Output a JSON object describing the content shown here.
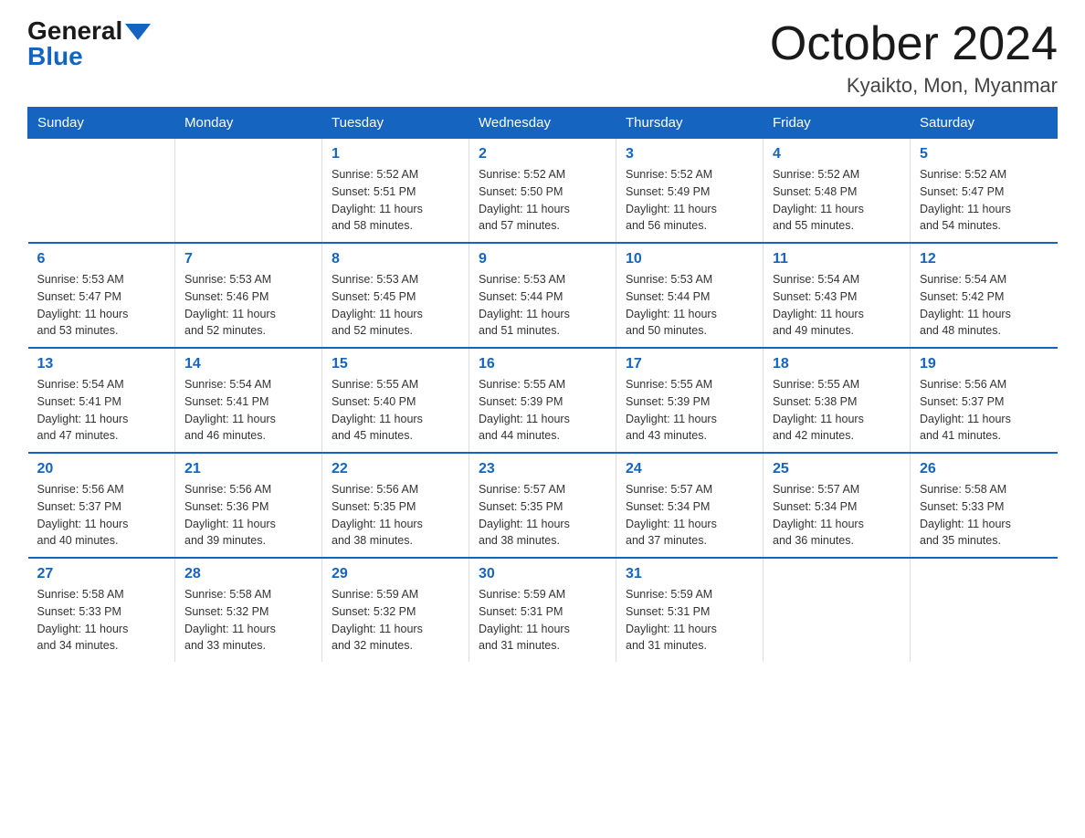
{
  "logo": {
    "general": "General",
    "blue": "Blue"
  },
  "title": "October 2024",
  "subtitle": "Kyaikto, Mon, Myanmar",
  "headers": [
    "Sunday",
    "Monday",
    "Tuesday",
    "Wednesday",
    "Thursday",
    "Friday",
    "Saturday"
  ],
  "weeks": [
    [
      {
        "day": "",
        "info": ""
      },
      {
        "day": "",
        "info": ""
      },
      {
        "day": "1",
        "info": "Sunrise: 5:52 AM\nSunset: 5:51 PM\nDaylight: 11 hours\nand 58 minutes."
      },
      {
        "day": "2",
        "info": "Sunrise: 5:52 AM\nSunset: 5:50 PM\nDaylight: 11 hours\nand 57 minutes."
      },
      {
        "day": "3",
        "info": "Sunrise: 5:52 AM\nSunset: 5:49 PM\nDaylight: 11 hours\nand 56 minutes."
      },
      {
        "day": "4",
        "info": "Sunrise: 5:52 AM\nSunset: 5:48 PM\nDaylight: 11 hours\nand 55 minutes."
      },
      {
        "day": "5",
        "info": "Sunrise: 5:52 AM\nSunset: 5:47 PM\nDaylight: 11 hours\nand 54 minutes."
      }
    ],
    [
      {
        "day": "6",
        "info": "Sunrise: 5:53 AM\nSunset: 5:47 PM\nDaylight: 11 hours\nand 53 minutes."
      },
      {
        "day": "7",
        "info": "Sunrise: 5:53 AM\nSunset: 5:46 PM\nDaylight: 11 hours\nand 52 minutes."
      },
      {
        "day": "8",
        "info": "Sunrise: 5:53 AM\nSunset: 5:45 PM\nDaylight: 11 hours\nand 52 minutes."
      },
      {
        "day": "9",
        "info": "Sunrise: 5:53 AM\nSunset: 5:44 PM\nDaylight: 11 hours\nand 51 minutes."
      },
      {
        "day": "10",
        "info": "Sunrise: 5:53 AM\nSunset: 5:44 PM\nDaylight: 11 hours\nand 50 minutes."
      },
      {
        "day": "11",
        "info": "Sunrise: 5:54 AM\nSunset: 5:43 PM\nDaylight: 11 hours\nand 49 minutes."
      },
      {
        "day": "12",
        "info": "Sunrise: 5:54 AM\nSunset: 5:42 PM\nDaylight: 11 hours\nand 48 minutes."
      }
    ],
    [
      {
        "day": "13",
        "info": "Sunrise: 5:54 AM\nSunset: 5:41 PM\nDaylight: 11 hours\nand 47 minutes."
      },
      {
        "day": "14",
        "info": "Sunrise: 5:54 AM\nSunset: 5:41 PM\nDaylight: 11 hours\nand 46 minutes."
      },
      {
        "day": "15",
        "info": "Sunrise: 5:55 AM\nSunset: 5:40 PM\nDaylight: 11 hours\nand 45 minutes."
      },
      {
        "day": "16",
        "info": "Sunrise: 5:55 AM\nSunset: 5:39 PM\nDaylight: 11 hours\nand 44 minutes."
      },
      {
        "day": "17",
        "info": "Sunrise: 5:55 AM\nSunset: 5:39 PM\nDaylight: 11 hours\nand 43 minutes."
      },
      {
        "day": "18",
        "info": "Sunrise: 5:55 AM\nSunset: 5:38 PM\nDaylight: 11 hours\nand 42 minutes."
      },
      {
        "day": "19",
        "info": "Sunrise: 5:56 AM\nSunset: 5:37 PM\nDaylight: 11 hours\nand 41 minutes."
      }
    ],
    [
      {
        "day": "20",
        "info": "Sunrise: 5:56 AM\nSunset: 5:37 PM\nDaylight: 11 hours\nand 40 minutes."
      },
      {
        "day": "21",
        "info": "Sunrise: 5:56 AM\nSunset: 5:36 PM\nDaylight: 11 hours\nand 39 minutes."
      },
      {
        "day": "22",
        "info": "Sunrise: 5:56 AM\nSunset: 5:35 PM\nDaylight: 11 hours\nand 38 minutes."
      },
      {
        "day": "23",
        "info": "Sunrise: 5:57 AM\nSunset: 5:35 PM\nDaylight: 11 hours\nand 38 minutes."
      },
      {
        "day": "24",
        "info": "Sunrise: 5:57 AM\nSunset: 5:34 PM\nDaylight: 11 hours\nand 37 minutes."
      },
      {
        "day": "25",
        "info": "Sunrise: 5:57 AM\nSunset: 5:34 PM\nDaylight: 11 hours\nand 36 minutes."
      },
      {
        "day": "26",
        "info": "Sunrise: 5:58 AM\nSunset: 5:33 PM\nDaylight: 11 hours\nand 35 minutes."
      }
    ],
    [
      {
        "day": "27",
        "info": "Sunrise: 5:58 AM\nSunset: 5:33 PM\nDaylight: 11 hours\nand 34 minutes."
      },
      {
        "day": "28",
        "info": "Sunrise: 5:58 AM\nSunset: 5:32 PM\nDaylight: 11 hours\nand 33 minutes."
      },
      {
        "day": "29",
        "info": "Sunrise: 5:59 AM\nSunset: 5:32 PM\nDaylight: 11 hours\nand 32 minutes."
      },
      {
        "day": "30",
        "info": "Sunrise: 5:59 AM\nSunset: 5:31 PM\nDaylight: 11 hours\nand 31 minutes."
      },
      {
        "day": "31",
        "info": "Sunrise: 5:59 AM\nSunset: 5:31 PM\nDaylight: 11 hours\nand 31 minutes."
      },
      {
        "day": "",
        "info": ""
      },
      {
        "day": "",
        "info": ""
      }
    ]
  ]
}
